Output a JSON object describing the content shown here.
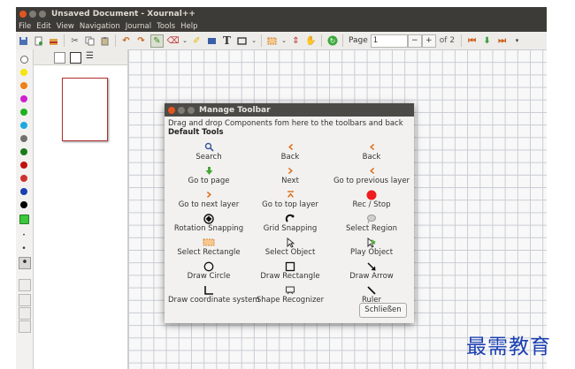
{
  "window": {
    "title": "Unsaved Document - Xournal++"
  },
  "menu": [
    "File",
    "Edit",
    "View",
    "Navigation",
    "Journal",
    "Tools",
    "Help"
  ],
  "toolbar": {
    "page_label": "Page",
    "page_value": "1",
    "minus": "−",
    "plus": "+",
    "of_pages": "of 2"
  },
  "palette_colors": [
    "#ffffff",
    "#f5e50a",
    "#f08018",
    "#d020d0",
    "#20b020",
    "#1ea8e0",
    "#707070",
    "#1a7a1a",
    "#c01010",
    "#d03030",
    "#1a3fb0",
    "#000000",
    "#38c838"
  ],
  "dialog": {
    "title": "Manage Toolbar",
    "instruction": "Drag and drop Components fom here to the toolbars and back",
    "section": "Default Tools",
    "close_label": "Schließen",
    "items": [
      {
        "label": "Search",
        "icon": "search-icon"
      },
      {
        "label": "Back",
        "icon": "back-icon"
      },
      {
        "label": "Back",
        "icon": "back-icon"
      },
      {
        "label": "Go to page",
        "icon": "goto-page-icon"
      },
      {
        "label": "Next",
        "icon": "next-icon"
      },
      {
        "label": "Go to previous layer",
        "icon": "previous-layer-icon"
      },
      {
        "label": "Go to next layer",
        "icon": "next-layer-icon"
      },
      {
        "label": "Go to top layer",
        "icon": "top-layer-icon"
      },
      {
        "label": "Rec / Stop",
        "icon": "record-icon"
      },
      {
        "label": "Rotation Snapping",
        "icon": "rotation-snapping-icon"
      },
      {
        "label": "Grid Snapping",
        "icon": "grid-snapping-icon"
      },
      {
        "label": "Select Region",
        "icon": "select-region-icon"
      },
      {
        "label": "Select Rectangle",
        "icon": "select-rectangle-icon"
      },
      {
        "label": "Select Object",
        "icon": "select-object-icon"
      },
      {
        "label": "Play Object",
        "icon": "play-object-icon"
      },
      {
        "label": "Draw Circle",
        "icon": "draw-circle-icon"
      },
      {
        "label": "Draw Rectangle",
        "icon": "draw-rectangle-icon"
      },
      {
        "label": "Draw Arrow",
        "icon": "draw-arrow-icon"
      },
      {
        "label": "Draw coordinate system",
        "icon": "coordinate-system-icon"
      },
      {
        "label": "Shape Recognizer",
        "icon": "shape-recognizer-icon"
      },
      {
        "label": "Ruler",
        "icon": "ruler-icon"
      }
    ]
  },
  "watermark": "最需教育"
}
